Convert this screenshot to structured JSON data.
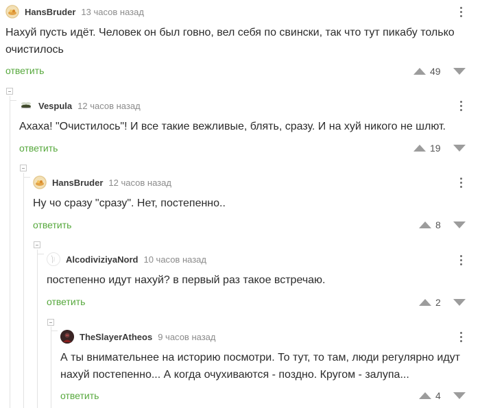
{
  "comments": [
    {
      "author": "HansBruder",
      "time": "13 часов назад",
      "text": "Нахуй пусть идёт. Человек он был говно, вел себя по свински, так что тут пикабу только очистилось",
      "reply_label": "ответить",
      "rating": "49",
      "avatar_icon": "food-plate-avatar"
    },
    {
      "author": "Vespula",
      "time": "12 часов назад",
      "text": "Ахаха! \"Очистилось\"! И все такие вежливые, блять, сразу. И на хуй никого не шлют.",
      "reply_label": "ответить",
      "rating": "19",
      "avatar_icon": "wasp-avatar"
    },
    {
      "author": "HansBruder",
      "time": "12 часов назад",
      "text": "Ну чо сразу \"сразу\". Нет, постепенно..",
      "reply_label": "ответить",
      "rating": "8",
      "avatar_icon": "food-plate-avatar"
    },
    {
      "author": "AlcodiviziyaNord",
      "time": "10 часов назад",
      "text": "постепенно идут нахуй? в первый раз такое встречаю.",
      "reply_label": "ответить",
      "rating": "2",
      "avatar_icon": "sketch-avatar"
    },
    {
      "author": "TheSlayerAtheos",
      "time": "9 часов назад",
      "text": "А ты внимательнее на историю посмотри. То тут, то там, люди регулярно идут нахуй постепенно... А когда очухиваются - поздно. Кругом - залупа...",
      "reply_label": "ответить",
      "rating": "4",
      "avatar_icon": "dark-figure-avatar"
    }
  ],
  "colors": {
    "reply_green": "#56a83c",
    "text": "#2b2b2b",
    "muted": "#8b8b8b",
    "vote_bg": "#f2f2f2",
    "arrow": "#9c9c9c"
  }
}
